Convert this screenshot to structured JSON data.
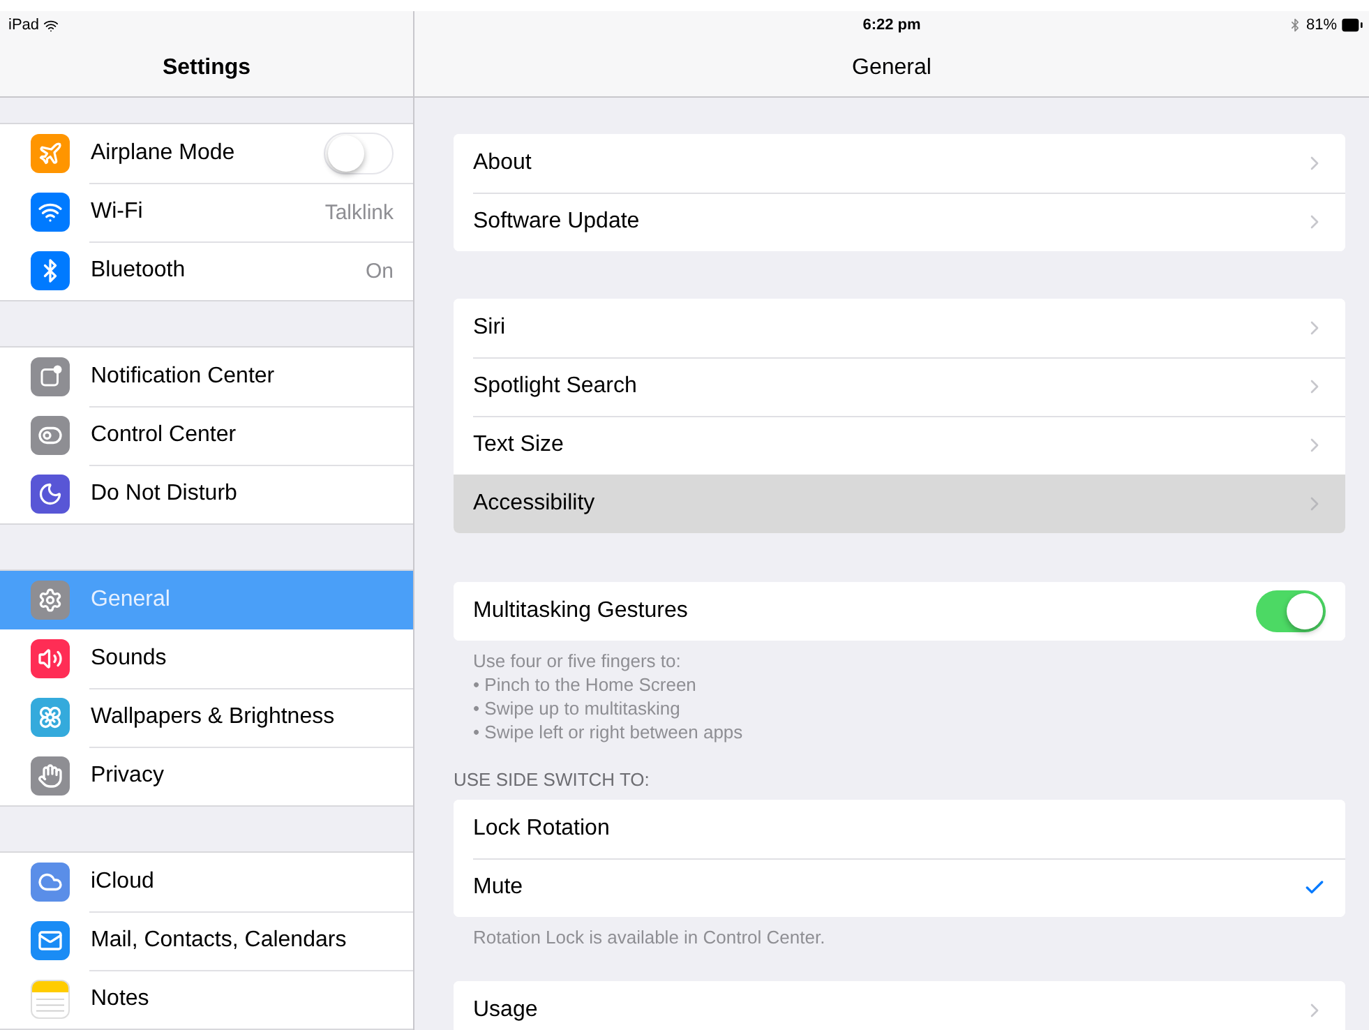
{
  "status_bar": {
    "carrier": "iPad",
    "time": "6:22 pm",
    "battery": "81%"
  },
  "sidebar": {
    "title": "Settings",
    "groups": [
      {
        "items": [
          {
            "label": "Airplane Mode",
            "color": "#ff9500",
            "kind": "toggle",
            "on": false,
            "selected": false
          },
          {
            "label": "Wi-Fi",
            "color": "#007aff",
            "kind": "value",
            "value": "Talklink",
            "selected": false
          },
          {
            "label": "Bluetooth",
            "color": "#007aff",
            "kind": "value",
            "value": "On",
            "selected": false
          }
        ]
      },
      {
        "items": [
          {
            "label": "Notification Center",
            "color": "#8e8e93",
            "kind": "plain",
            "selected": false
          },
          {
            "label": "Control Center",
            "color": "#8e8e93",
            "kind": "plain",
            "selected": false
          },
          {
            "label": "Do Not Disturb",
            "color": "#5856d6",
            "kind": "plain",
            "selected": false
          }
        ]
      },
      {
        "items": [
          {
            "label": "General",
            "color": "#8e8e93",
            "kind": "plain",
            "selected": true
          },
          {
            "label": "Sounds",
            "color": "#ff2d55",
            "kind": "plain",
            "selected": false
          },
          {
            "label": "Wallpapers & Brightness",
            "color": "#34aadc",
            "kind": "plain",
            "selected": false
          },
          {
            "label": "Privacy",
            "color": "#8e8e93",
            "kind": "plain",
            "selected": false
          }
        ]
      },
      {
        "items": [
          {
            "label": "iCloud",
            "color": "#5a8ee8",
            "kind": "plain",
            "selected": false
          },
          {
            "label": "Mail, Contacts, Calendars",
            "color": "#1a8cf5",
            "kind": "plain",
            "selected": false
          },
          {
            "label": "Notes",
            "color": "#ffcc00",
            "kind": "plain",
            "selected": false
          }
        ]
      }
    ]
  },
  "detail": {
    "title": "General",
    "groups": [
      {
        "rows": [
          {
            "label": "About",
            "kind": "link",
            "selected": false
          },
          {
            "label": "Software Update",
            "kind": "link",
            "selected": false
          }
        ]
      },
      {
        "rows": [
          {
            "label": "Siri",
            "kind": "link",
            "selected": false
          },
          {
            "label": "Spotlight Search",
            "kind": "link",
            "selected": false
          },
          {
            "label": "Text Size",
            "kind": "link",
            "selected": false
          },
          {
            "label": "Accessibility",
            "kind": "link",
            "selected": true
          }
        ]
      },
      {
        "rows": [
          {
            "label": "Multitasking Gestures",
            "kind": "toggle",
            "on": true
          }
        ],
        "footer": [
          "Use four or five fingers to:",
          "• Pinch to the Home Screen",
          "• Swipe up to multitasking",
          "• Swipe left or right between apps"
        ]
      },
      {
        "header": "USE SIDE SWITCH TO:",
        "rows": [
          {
            "label": "Lock Rotation",
            "kind": "check",
            "checked": false
          },
          {
            "label": "Mute",
            "kind": "check",
            "checked": true
          }
        ],
        "footer": [
          "Rotation Lock is available in Control Center."
        ]
      },
      {
        "rows": [
          {
            "label": "Usage",
            "kind": "link",
            "selected": false
          }
        ]
      }
    ]
  }
}
